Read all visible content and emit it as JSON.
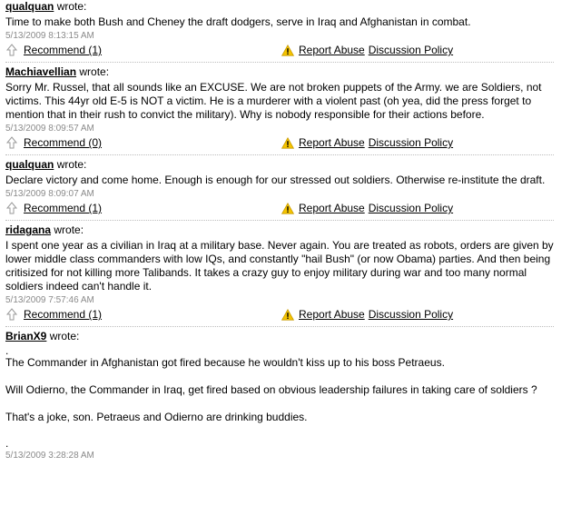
{
  "comments": [
    {
      "author": "qualquan",
      "wrote": "wrote:",
      "paragraphs": [
        "Time to make both Bush and Cheney the draft dodgers, serve in Iraq and Afghanistan in combat."
      ],
      "timestamp": "5/13/2009 8:13:15 AM",
      "recommend": "Recommend (1)"
    },
    {
      "author": "Machiavellian",
      "wrote": "wrote:",
      "paragraphs": [
        "Sorry Mr. Russel, that all sounds like an EXCUSE. We are not broken puppets of the Army. we are Soldiers, not victims. This 44yr old E-5 is NOT a victim. He is a murderer with a violent past (oh yea, did the press forget to mention that in their rush to convict the military). Why is nobody responsible for their actions before."
      ],
      "timestamp": "5/13/2009 8:09:57 AM",
      "recommend": "Recommend (0)"
    },
    {
      "author": "qualquan",
      "wrote": "wrote:",
      "paragraphs": [
        "Declare victory and come home. Enough is enough for our stressed out soldiers. Otherwise re-institute the draft."
      ],
      "timestamp": "5/13/2009 8:09:07 AM",
      "recommend": "Recommend (1)"
    },
    {
      "author": "ridagana",
      "wrote": "wrote:",
      "paragraphs": [
        "I spent one year as a civilian in Iraq at a military base. Never again. You are treated as robots, orders are given by lower middle class commanders with low IQs, and constantly \"hail Bush\" (or now Obama) parties. And then being critisized for not killing more Talibands. It takes a crazy guy to enjoy military during war and too many normal soldiers indeed can't handle it."
      ],
      "timestamp": "5/13/2009 7:57:46 AM",
      "recommend": "Recommend (1)"
    },
    {
      "author": "BrianX9",
      "wrote": "wrote:",
      "lead_dot": ".",
      "paragraphs": [
        "The Commander in Afghanistan got fired because he wouldn't kiss up to his boss Petraeus.",
        "Will Odierno, the Commander in Iraq, get fired based on obvious leadership failures in taking care of soldiers ?",
        "That's a joke, son. Petraeus and Odierno are drinking buddies."
      ],
      "trail_dot": ".",
      "timestamp": "5/13/2009 3:28:28 AM"
    }
  ],
  "report_abuse": "Report Abuse",
  "discussion_policy": "Discussion Policy",
  "icons": {
    "recommend": "thumbs-up-arrow-icon",
    "report": "warning-triangle-icon"
  },
  "colors": {
    "timestamp": "#8a8a8a",
    "warning": "#f5c400",
    "divider": "#bdbdbd"
  }
}
